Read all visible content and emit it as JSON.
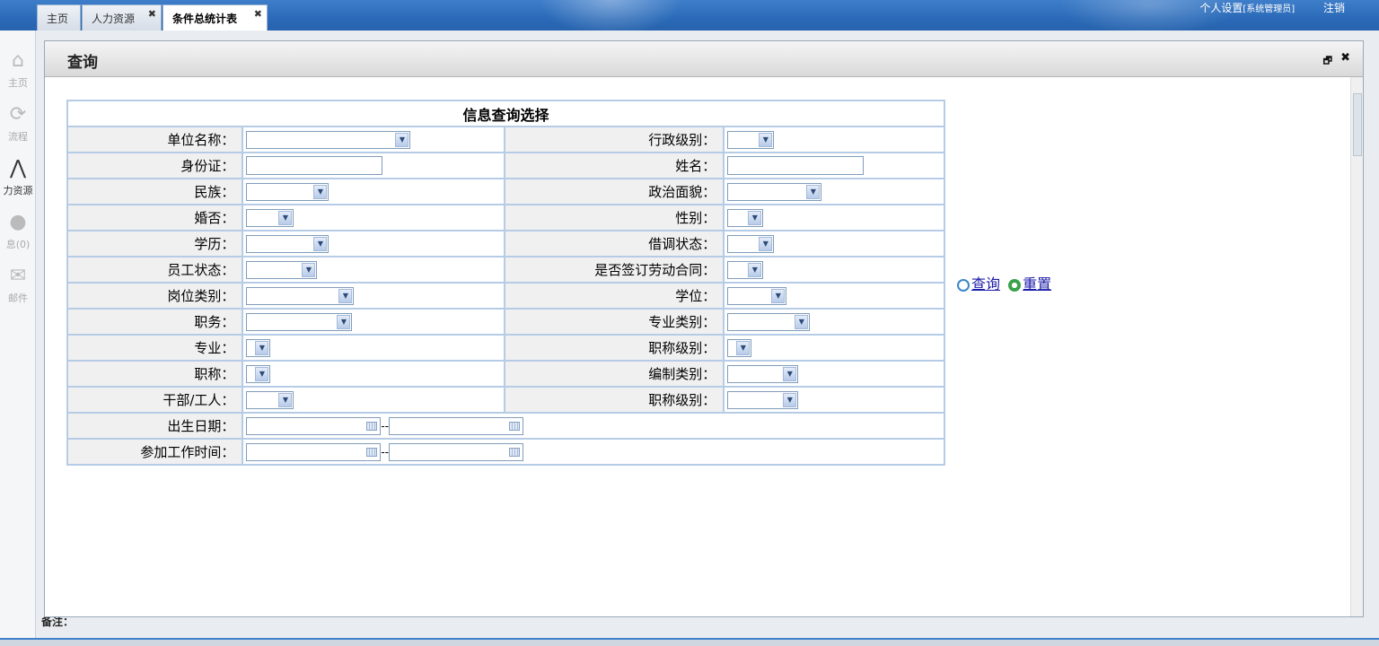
{
  "tabs": [
    {
      "label": "主页",
      "closable": false
    },
    {
      "label": "人力资源",
      "closable": true
    },
    {
      "label": "条件总统计表",
      "closable": true,
      "active": true
    }
  ],
  "top_links": {
    "settings": "个人设置",
    "role": "[系统管理员]",
    "logout": "注销"
  },
  "sidebar": [
    {
      "label": "主页",
      "icon": "home-icon"
    },
    {
      "label": "流程",
      "icon": "refresh-icon"
    },
    {
      "label": "力资源",
      "icon": "people-icon",
      "active": true
    },
    {
      "label": "息(0)",
      "icon": "user-icon"
    },
    {
      "label": "邮件",
      "icon": "mail-icon"
    }
  ],
  "dialog": {
    "title": "查询",
    "restore_glyph": "🗗",
    "close_glyph": "✖"
  },
  "table": {
    "caption": "信息查询选择",
    "rows": [
      {
        "l": "单位名称：",
        "r": "行政级别："
      },
      {
        "l": "身份证：",
        "r": "姓名："
      },
      {
        "l": "民族：",
        "r": "政治面貌："
      },
      {
        "l": "婚否：",
        "r": "性别："
      },
      {
        "l": "学历：",
        "r": "借调状态："
      },
      {
        "l": "员工状态：",
        "r": "是否签订劳动合同："
      },
      {
        "l": "岗位类别：",
        "r": "学位："
      },
      {
        "l": "职务：",
        "r": "专业类别："
      },
      {
        "l": "专业：",
        "r": "职称级别："
      },
      {
        "l": "职称：",
        "r": "编制类别："
      },
      {
        "l": "干部/工人：",
        "r": "职称级别："
      }
    ],
    "birth_label": "出生日期：",
    "work_label": "参加工作时间：",
    "range_sep": "--"
  },
  "actions": {
    "search": "查询",
    "reset": "重置"
  },
  "remark": "备注："
}
